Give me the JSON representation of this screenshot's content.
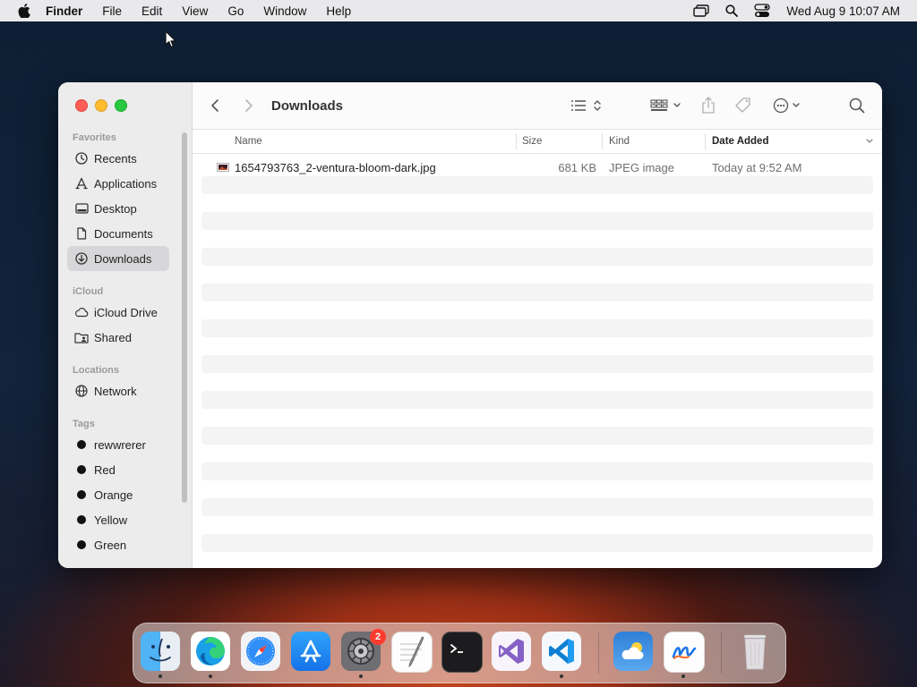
{
  "menubar": {
    "app_name": "Finder",
    "menus": [
      "File",
      "Edit",
      "View",
      "Go",
      "Window",
      "Help"
    ],
    "clock": "Wed Aug 9  10:07 AM"
  },
  "window": {
    "title": "Downloads",
    "sidebar": {
      "favorites_label": "Favorites",
      "favorites": [
        "Recents",
        "Applications",
        "Desktop",
        "Documents",
        "Downloads"
      ],
      "selected": "Downloads",
      "icloud_label": "iCloud",
      "icloud": [
        "iCloud Drive",
        "Shared"
      ],
      "locations_label": "Locations",
      "locations": [
        "Network"
      ],
      "tags_label": "Tags",
      "tags": [
        "rewwrerer",
        "Red",
        "Orange",
        "Yellow",
        "Green"
      ]
    },
    "columns": {
      "name": "Name",
      "size": "Size",
      "kind": "Kind",
      "date_added": "Date Added"
    },
    "files": [
      {
        "name": "1654793763_2-ventura-bloom-dark.jpg",
        "size": "681 KB",
        "kind": "JPEG image",
        "date_added": "Today at 9:52 AM"
      }
    ]
  },
  "dock": {
    "apps": [
      "Finder",
      "Microsoft Edge",
      "Safari",
      "App Store",
      "System Settings",
      "TextEdit",
      "Terminal",
      "Visual Studio",
      "Visual Studio Code",
      "Weather",
      "Freeform",
      "Trash"
    ],
    "settings_badge": "2"
  },
  "colors": {
    "traffic_red": "#ff5f57",
    "traffic_yellow": "#febc2e",
    "traffic_green": "#28c840",
    "selection_gray": "#d7d7d9"
  }
}
